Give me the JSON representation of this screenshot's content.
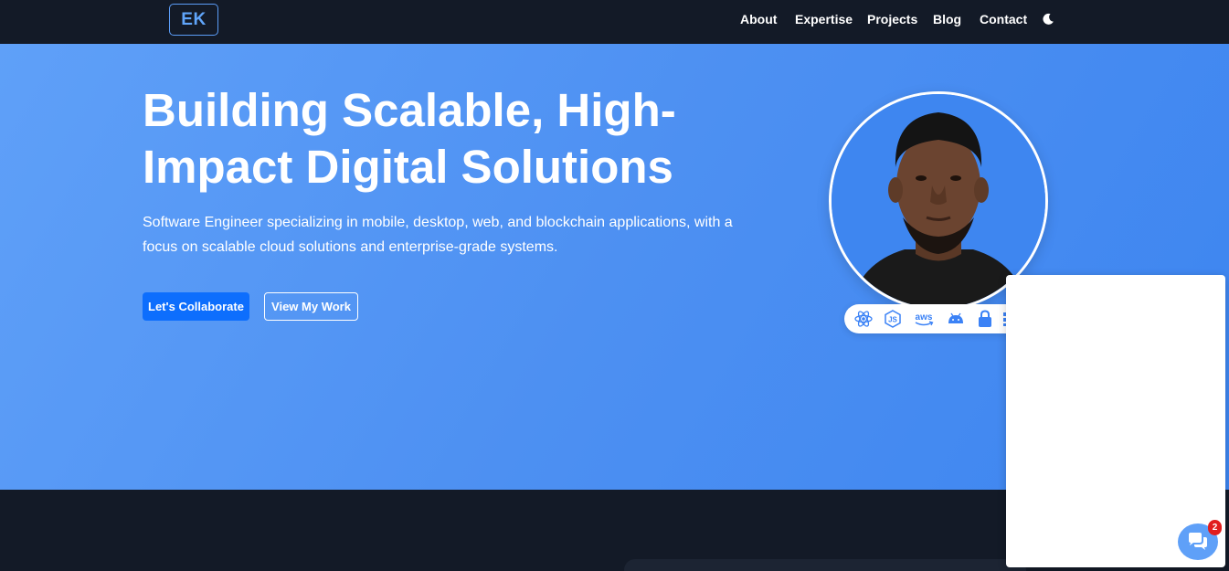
{
  "brand": {
    "logo_text": "EK"
  },
  "nav": {
    "links": [
      "About",
      "Expertise",
      "Projects",
      "Blog",
      "Contact"
    ],
    "theme_toggle_icon": "moon-icon"
  },
  "hero": {
    "title": "Building Scalable, High-Impact Digital Solutions",
    "subtitle": "Software Engineer specializing in mobile, desktop, web, and blockchain applications, with a focus on scalable cloud solutions and enterprise-grade systems.",
    "primary_button": "Let's Collaborate",
    "secondary_button": "View My Work",
    "tech_icons": [
      "react-icon",
      "nodejs-icon",
      "aws-icon",
      "android-icon",
      "lock-icon"
    ],
    "aws_text": "aws"
  },
  "chat": {
    "badge_count": "2",
    "icon": "chat-bubbles-icon"
  },
  "colors": {
    "nav_bg": "#131a27",
    "hero_gradient_start": "#5fa0f8",
    "hero_gradient_end": "#3d85f0",
    "primary_button": "#0d6efd",
    "logo_accent": "#60a5fa",
    "badge_red": "#e11d1d"
  }
}
